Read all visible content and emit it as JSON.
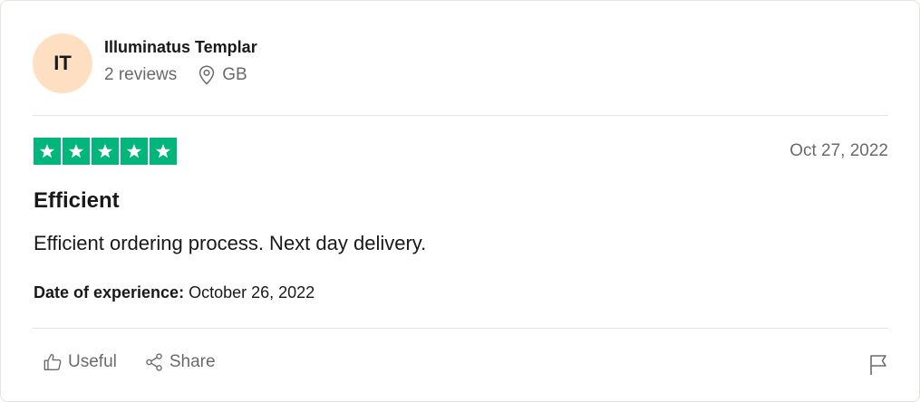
{
  "consumer": {
    "initials": "IT",
    "name": "Illuminatus Templar",
    "reviews": "2 reviews",
    "country": "GB"
  },
  "review": {
    "rating": 5,
    "date": "Oct 27, 2022",
    "title": "Efficient",
    "body": "Efficient ordering process. Next day delivery.",
    "experience_label": "Date of experience:",
    "experience_date": "October 26, 2022"
  },
  "actions": {
    "useful_label": "Useful",
    "share_label": "Share"
  },
  "icons": {
    "location": "location-pin-icon",
    "useful": "thumbs-up-icon",
    "share": "share-icon",
    "report": "flag-icon",
    "star": "star-icon"
  },
  "colors": {
    "avatar_bg": "#ffdfc1",
    "star_bg": "#00b67a",
    "muted_text": "#6a6a6a",
    "divider": "#e5e5dd"
  }
}
